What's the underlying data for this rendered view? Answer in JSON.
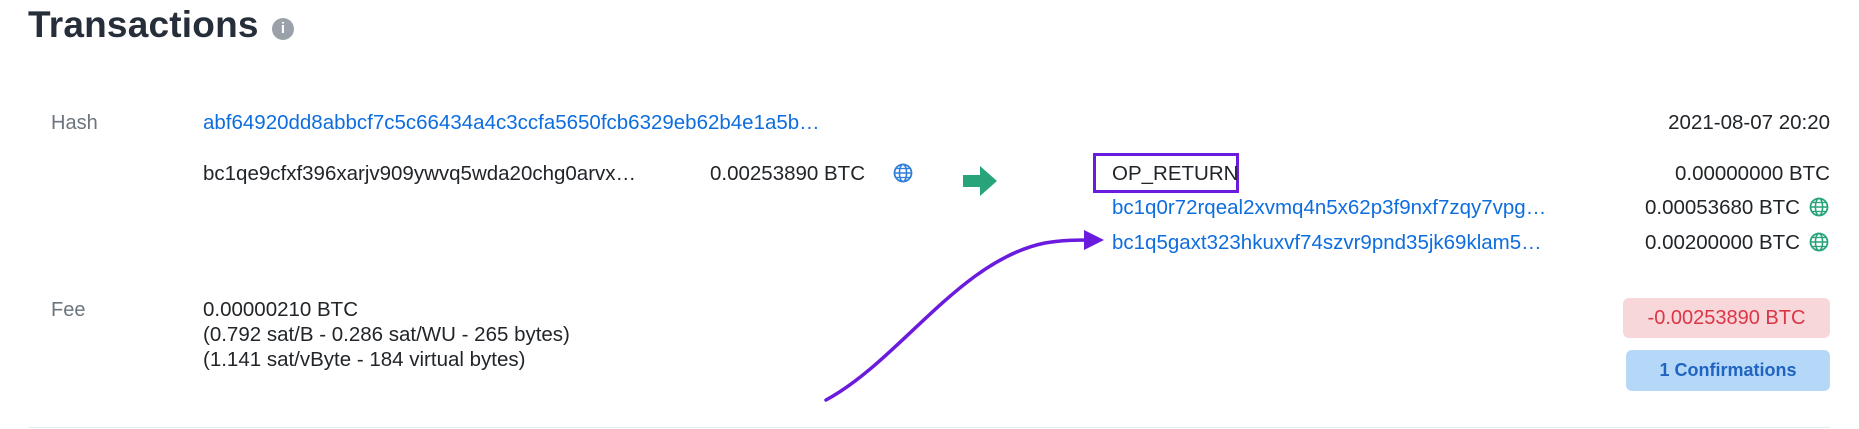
{
  "header": {
    "title": "Transactions",
    "info_icon": "i"
  },
  "tx": {
    "hash_label": "Hash",
    "hash": "abf64920dd8abbcf7c5c66434a4c3ccfa5650fcb6329eb62b4e1a5b…",
    "timestamp": "2021-08-07 20:20",
    "input": {
      "address": "bc1qe9cfxf396xarjv909ywvq5wda20chg0arvx…",
      "amount": "0.00253890 BTC"
    },
    "outputs": [
      {
        "address": "OP_RETURN",
        "amount": "0.00000000 BTC"
      },
      {
        "address": "bc1q0r72rqeal2xvmq4n5x62p3f9nxf7zqy7vpg…",
        "amount": "0.00053680 BTC"
      },
      {
        "address": "bc1q5gaxt323hkuxvf74szvr9pnd35jk69klam5…",
        "amount": "0.00200000 BTC"
      }
    ],
    "fee_label": "Fee",
    "fee": "0.00000210 BTC",
    "fee_detail_1": "(0.792 sat/B - 0.286 sat/WU - 265 bytes)",
    "fee_detail_2": "(1.141 sat/vByte - 184 virtual bytes)",
    "net_amount": "-0.00253890 BTC",
    "confirmations": "1 Confirmations"
  },
  "colors": {
    "link": "#0d6dde",
    "arrow": "#28a47a",
    "highlight": "#6a1bdd",
    "negative_bg": "#f8d7da",
    "negative_text": "#dc3545",
    "confirm_bg": "#b6d8f8",
    "confirm_text": "#1e64c0",
    "globe_input": "#2f7fd8",
    "globe_output": "#28a47a"
  },
  "icons": {
    "info": "info-circle-icon",
    "globe": "globe-icon",
    "flow_arrow": "arrow-right-icon",
    "annotation_arrow": "curved-arrow-annotation"
  }
}
